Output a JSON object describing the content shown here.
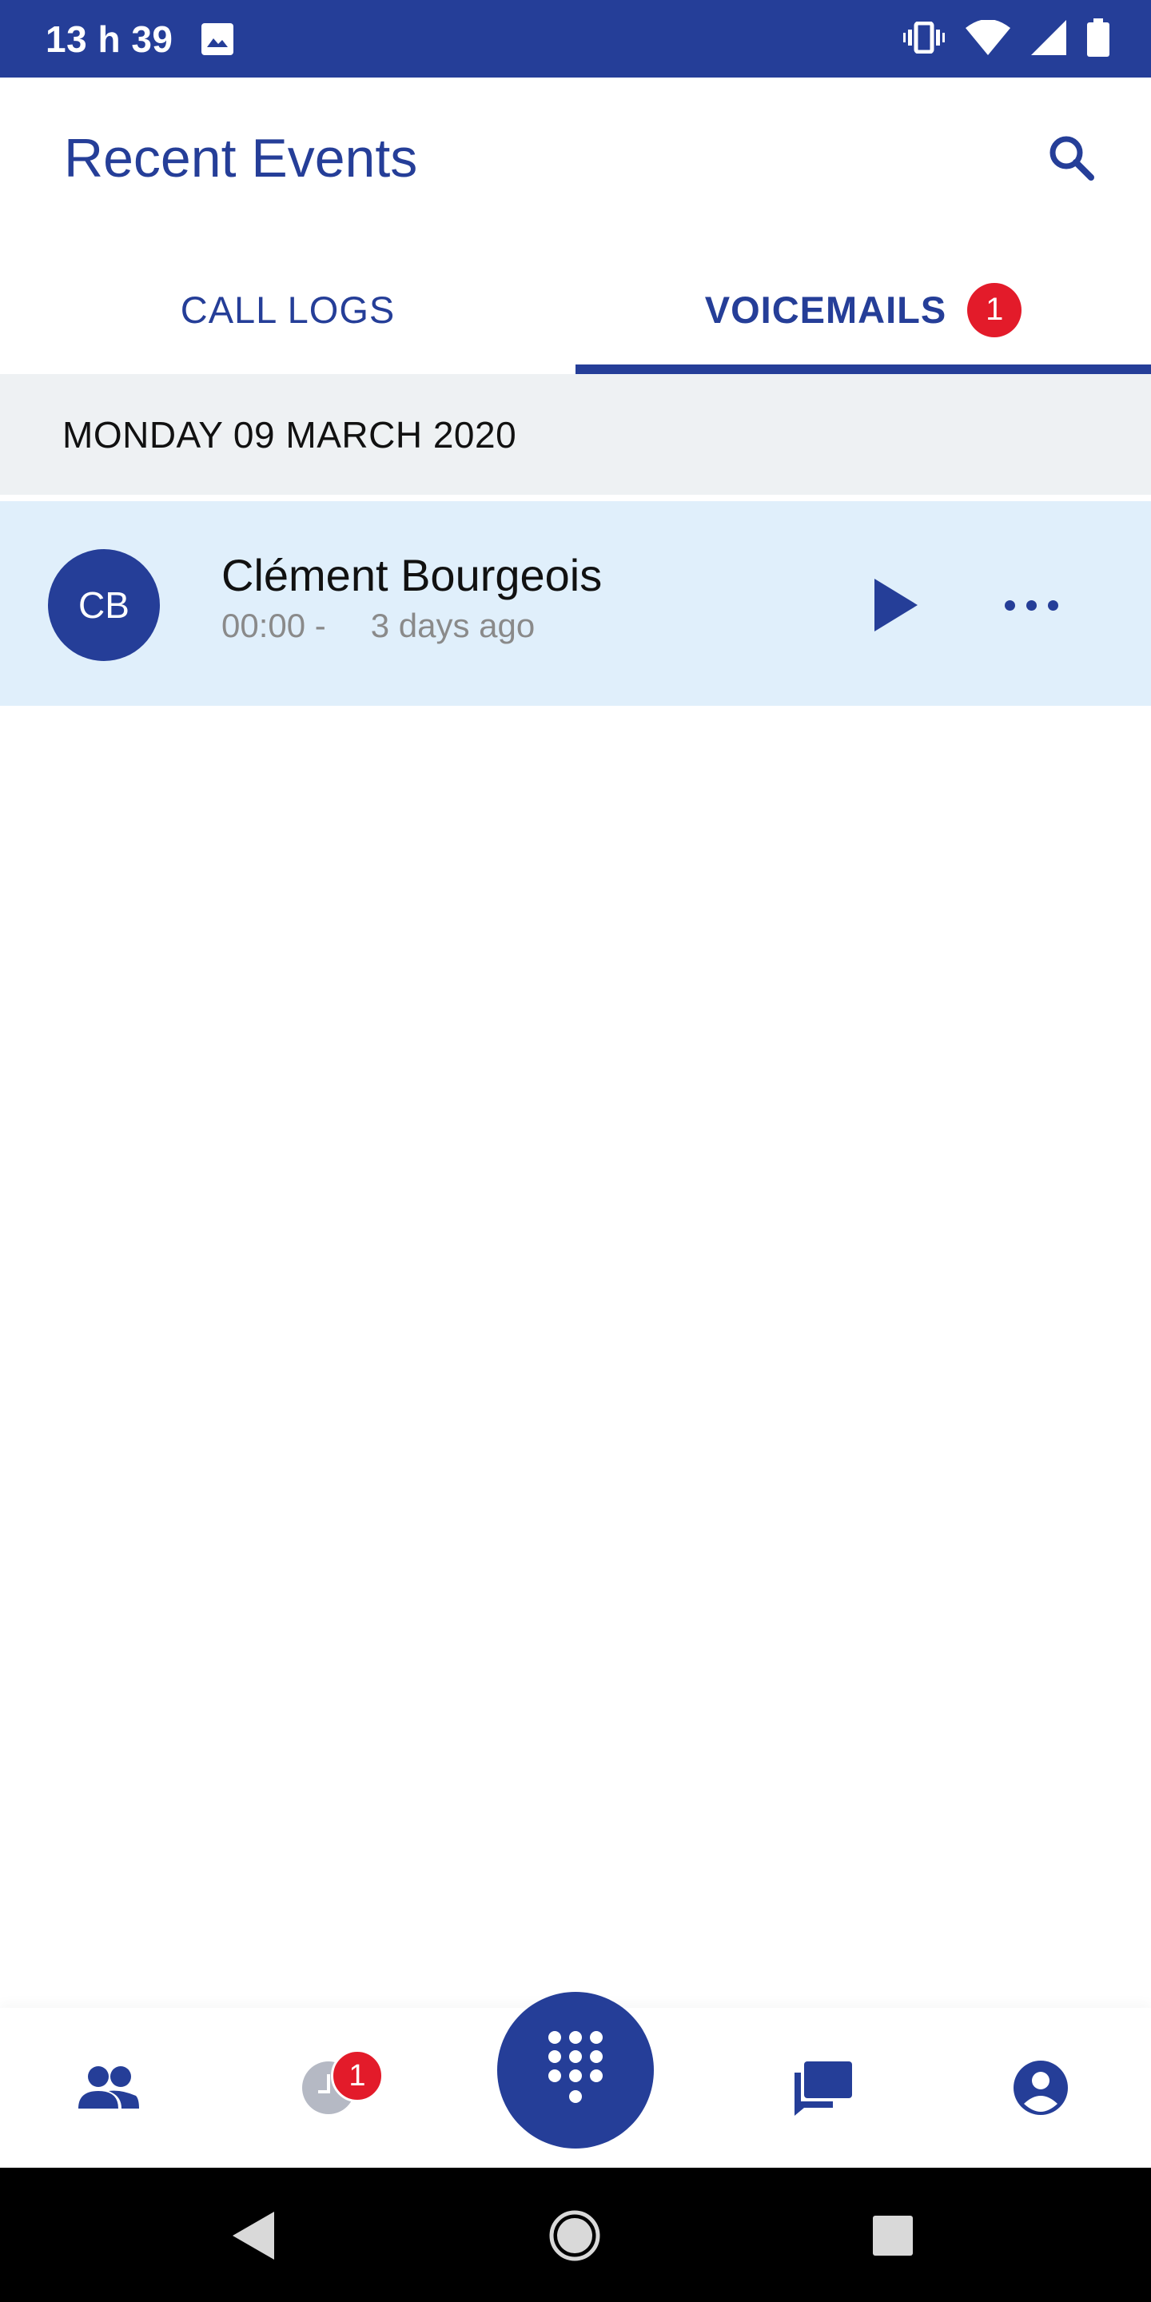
{
  "status_bar": {
    "time": "13 h 39",
    "icons": [
      "image-icon",
      "vibrate-icon",
      "wifi-icon",
      "signal-icon",
      "battery-icon"
    ]
  },
  "header": {
    "title": "Recent Events",
    "search_icon": "search-icon"
  },
  "tabs": [
    {
      "label": "CALL LOGS",
      "active": false
    },
    {
      "label": "VOICEMAILS",
      "active": true,
      "badge": "1"
    }
  ],
  "voicemails": {
    "date_header": "MONDAY 09 MARCH 2020",
    "items": [
      {
        "initials": "CB",
        "name": "Clément Bourgeois",
        "duration": "00:00 -",
        "age": "3 days ago"
      }
    ]
  },
  "bottom_nav": {
    "items": [
      {
        "icon": "contacts-icon"
      },
      {
        "icon": "recent-events-icon",
        "badge": "1"
      },
      {
        "icon": "dialpad-icon"
      },
      {
        "icon": "chat-icon"
      },
      {
        "icon": "profile-icon"
      }
    ]
  },
  "colors": {
    "primary": "#253e98",
    "badge": "#e31b2a",
    "row_highlight": "#e0effb",
    "date_header_bg": "#eef1f3"
  }
}
